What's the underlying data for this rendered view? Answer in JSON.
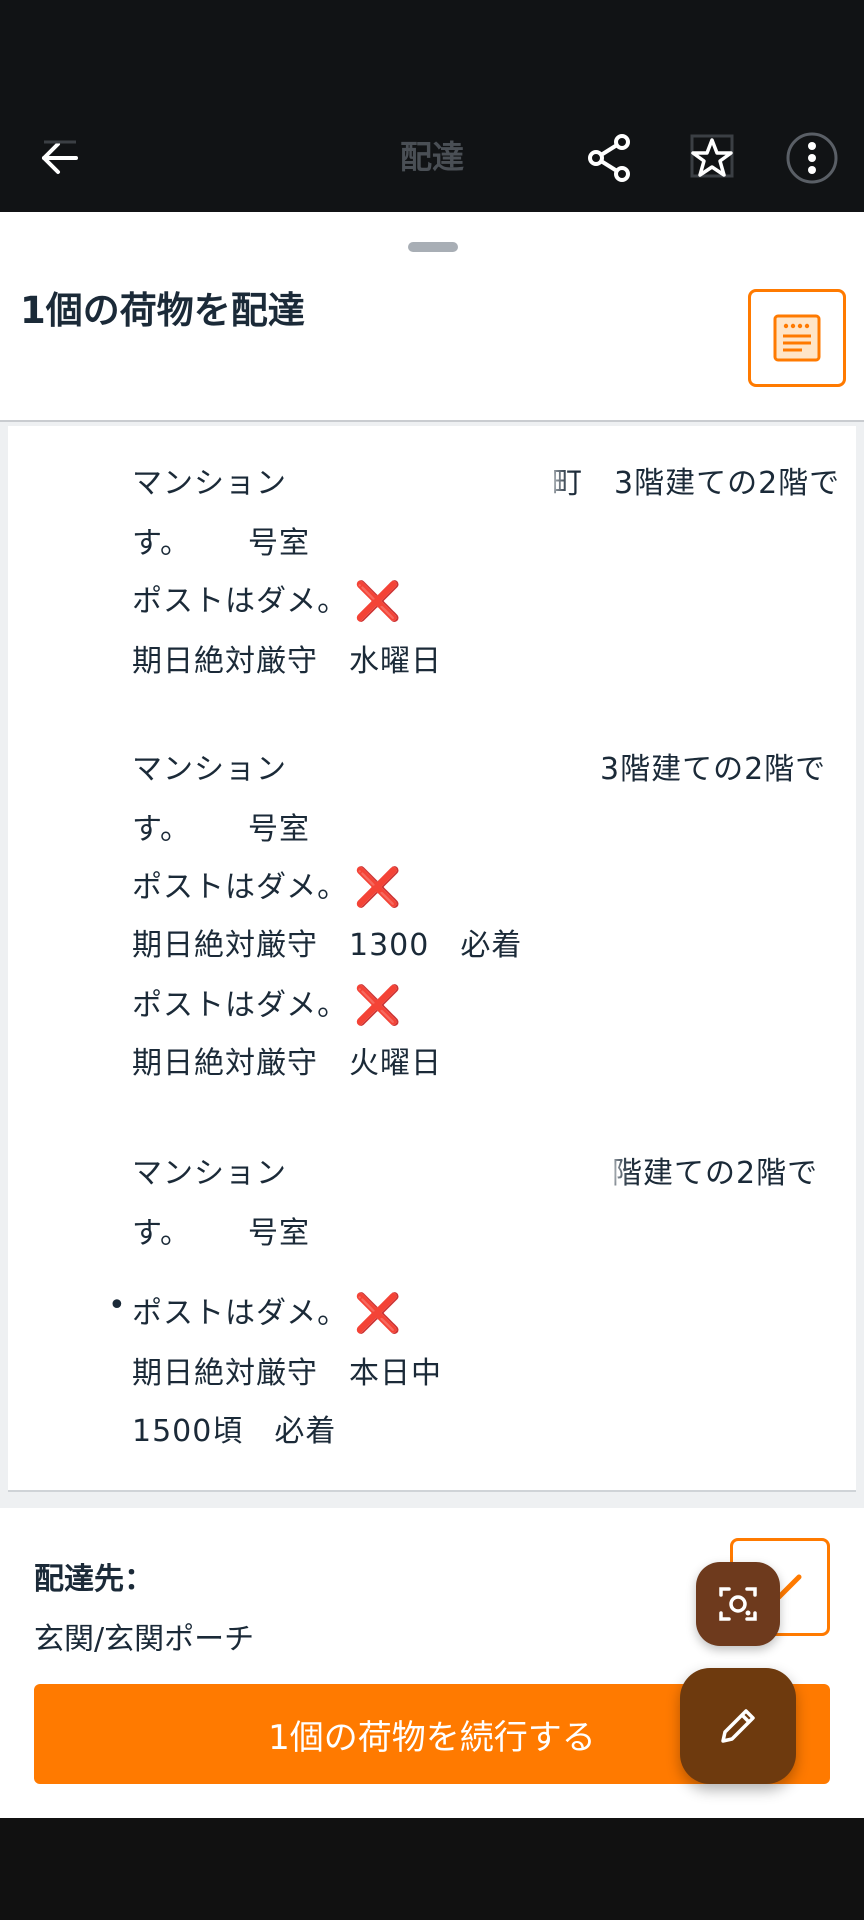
{
  "app_bar": {
    "title": "配達",
    "icons": [
      "back-arrow-icon",
      "share-icon",
      "bookmark-star-icon",
      "more-icon"
    ]
  },
  "sheet": {
    "title": "1個の荷物を配達"
  },
  "notes": {
    "block1": {
      "line1_start": "マンション",
      "line1_end": "町　3階建ての2階で",
      "line2_start": "す。",
      "line2_end": "号室",
      "line3": "ポストはダメ。",
      "line4": "期日絶対厳守　水曜日"
    },
    "block2": {
      "line1_start": "マンション",
      "line1_end": "3階建ての2階で",
      "line2_start": "す。",
      "line2_end": "号室",
      "line3": "ポストはダメ。",
      "line4": "期日絶対厳守　1300　必着",
      "line5": "ポストはダメ。",
      "line6": "期日絶対厳守　火曜日"
    },
    "block3": {
      "line1_start": "マンション",
      "line1_end": "階建ての2階で",
      "line2_start": "す。",
      "line2_end": "号室",
      "line3": "ポストはダメ。",
      "line4": "期日絶対厳守　本日中",
      "line5": "1500頃　必着"
    },
    "x_mark": "❌",
    "bullet": "•"
  },
  "footer": {
    "destination_label": "配達先：",
    "destination_value": "玄関/玄関ポーチ",
    "continue_label": "1個の荷物を続行する"
  },
  "colors": {
    "accent": "#ff7a00",
    "fab": "#6e3a0e",
    "x_mark": "#e0263a"
  }
}
